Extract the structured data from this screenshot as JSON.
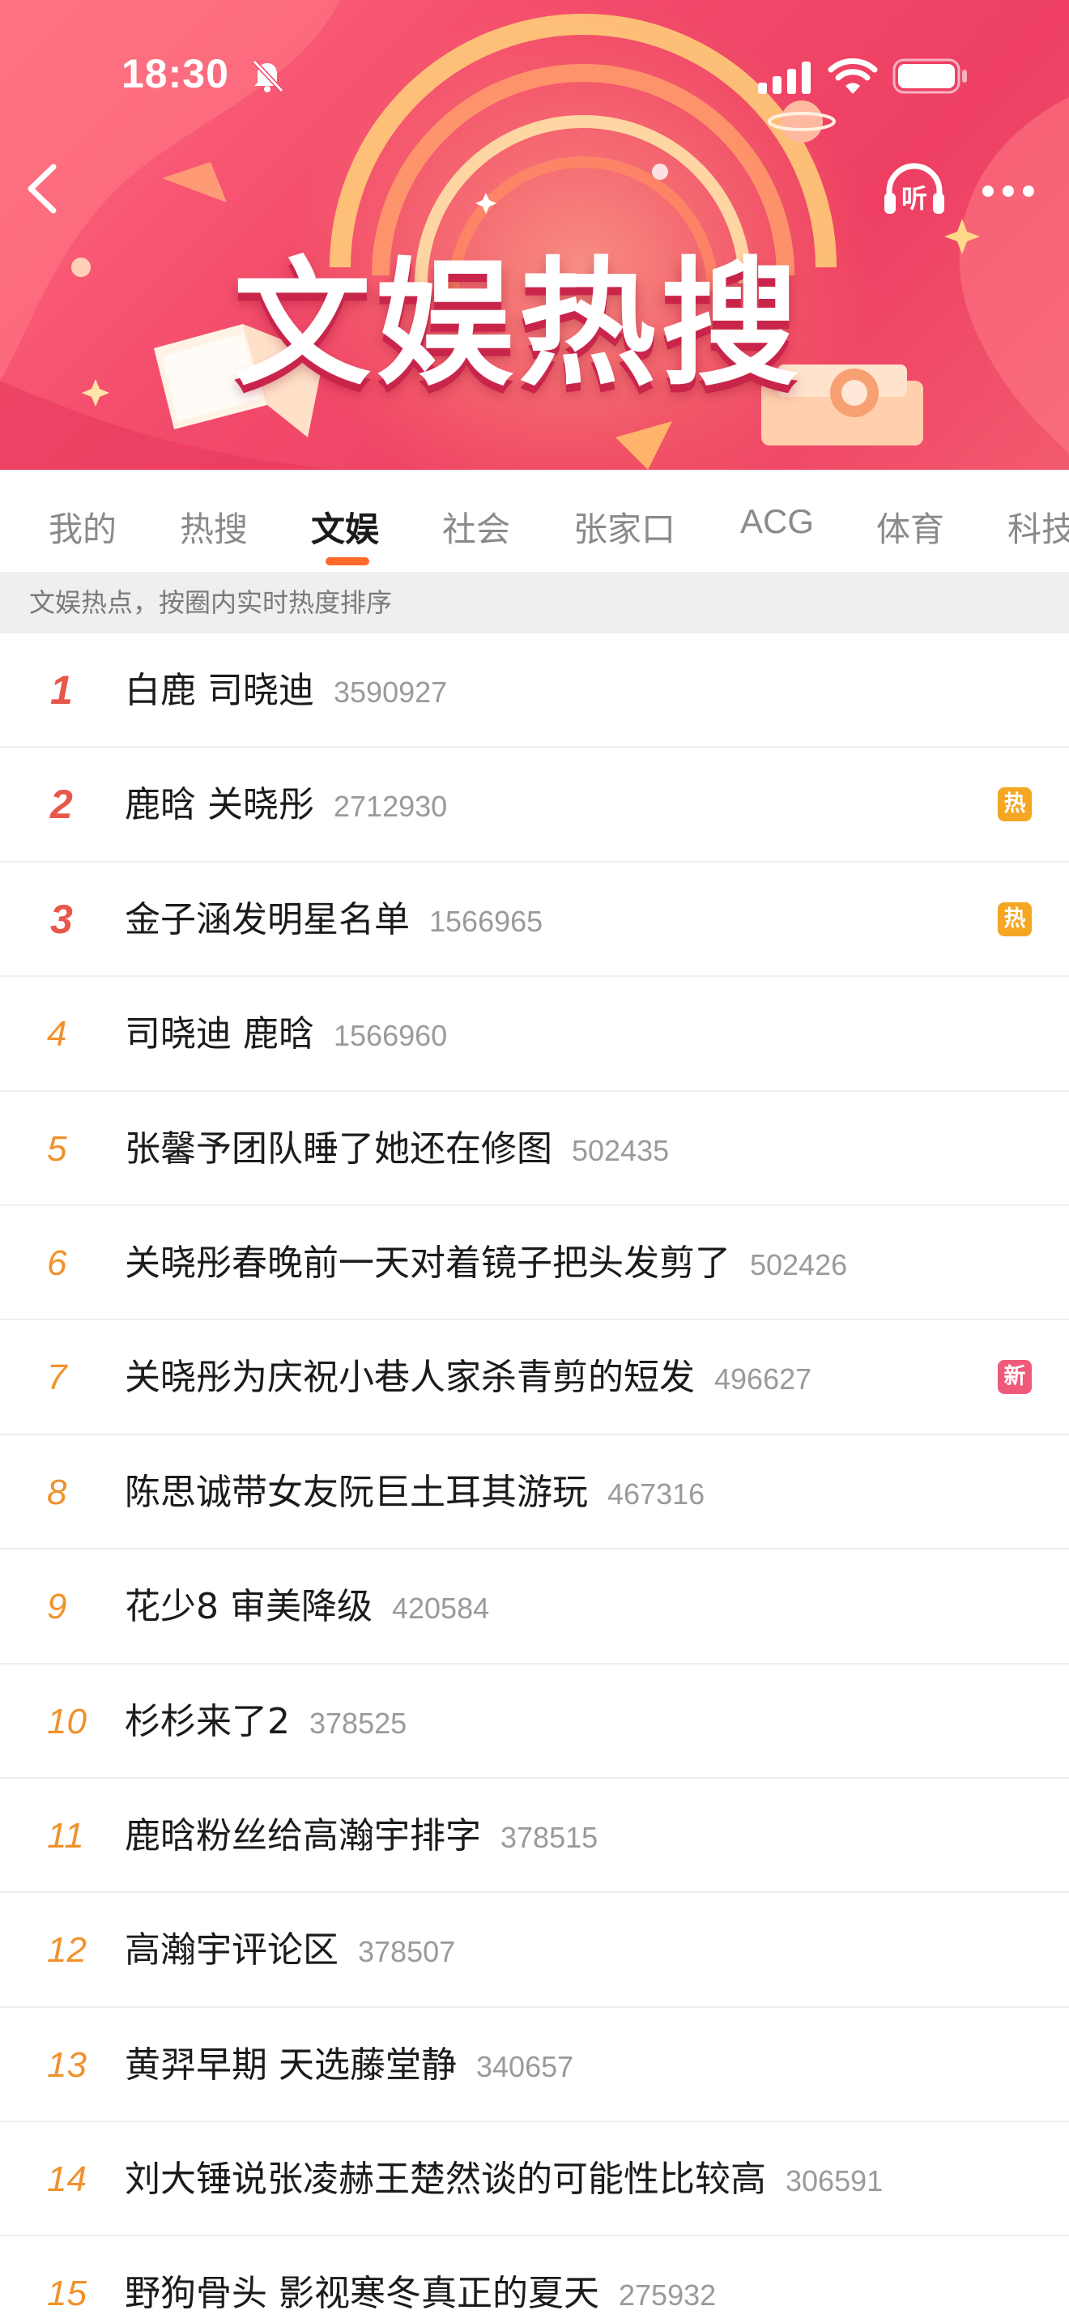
{
  "status_bar": {
    "time": "18:30"
  },
  "banner": {
    "title": "文娱热搜",
    "listen_label": "听"
  },
  "colors": {
    "accent": "#ff6a2b",
    "rank_top": "#e8574b",
    "rank_other": "#f0922c",
    "hot_badge": "#f5a623",
    "new_badge": "#ef5a7a"
  },
  "tabs": [
    {
      "label": "我的"
    },
    {
      "label": "热搜"
    },
    {
      "label": "文娱",
      "active": true
    },
    {
      "label": "社会"
    },
    {
      "label": "张家口"
    },
    {
      "label": "ACG"
    },
    {
      "label": "体育"
    },
    {
      "label": "科技"
    }
  ],
  "notice": "文娱热点，按圈内实时热度排序",
  "list": [
    {
      "rank": "1",
      "title": "白鹿 司晓迪",
      "count": "3590927",
      "badge": ""
    },
    {
      "rank": "2",
      "title": "鹿晗 关晓彤",
      "count": "2712930",
      "badge": "热"
    },
    {
      "rank": "3",
      "title": "金子涵发明星名单",
      "count": "1566965",
      "badge": "热"
    },
    {
      "rank": "4",
      "title": "司晓迪 鹿晗",
      "count": "1566960",
      "badge": ""
    },
    {
      "rank": "5",
      "title": "张馨予团队睡了她还在修图",
      "count": "502435",
      "badge": ""
    },
    {
      "rank": "6",
      "title": "关晓彤春晚前一天对着镜子把头发剪了",
      "count": "502426",
      "badge": ""
    },
    {
      "rank": "7",
      "title": "关晓彤为庆祝小巷人家杀青剪的短发",
      "count": "496627",
      "badge": "新"
    },
    {
      "rank": "8",
      "title": "陈思诚带女友阮巨土耳其游玩",
      "count": "467316",
      "badge": ""
    },
    {
      "rank": "9",
      "title": "花少8 审美降级",
      "count": "420584",
      "badge": ""
    },
    {
      "rank": "10",
      "title": "杉杉来了2",
      "count": "378525",
      "badge": ""
    },
    {
      "rank": "11",
      "title": "鹿晗粉丝给高瀚宇排字",
      "count": "378515",
      "badge": ""
    },
    {
      "rank": "12",
      "title": "高瀚宇评论区",
      "count": "378507",
      "badge": ""
    },
    {
      "rank": "13",
      "title": "黄羿早期 天选藤堂静",
      "count": "340657",
      "badge": ""
    },
    {
      "rank": "14",
      "title": "刘大锤说张凌赫王楚然谈的可能性比较高",
      "count": "306591",
      "badge": ""
    },
    {
      "rank": "15",
      "title": "野狗骨头 影视寒冬真正的夏天",
      "count": "275932",
      "badge": ""
    }
  ]
}
